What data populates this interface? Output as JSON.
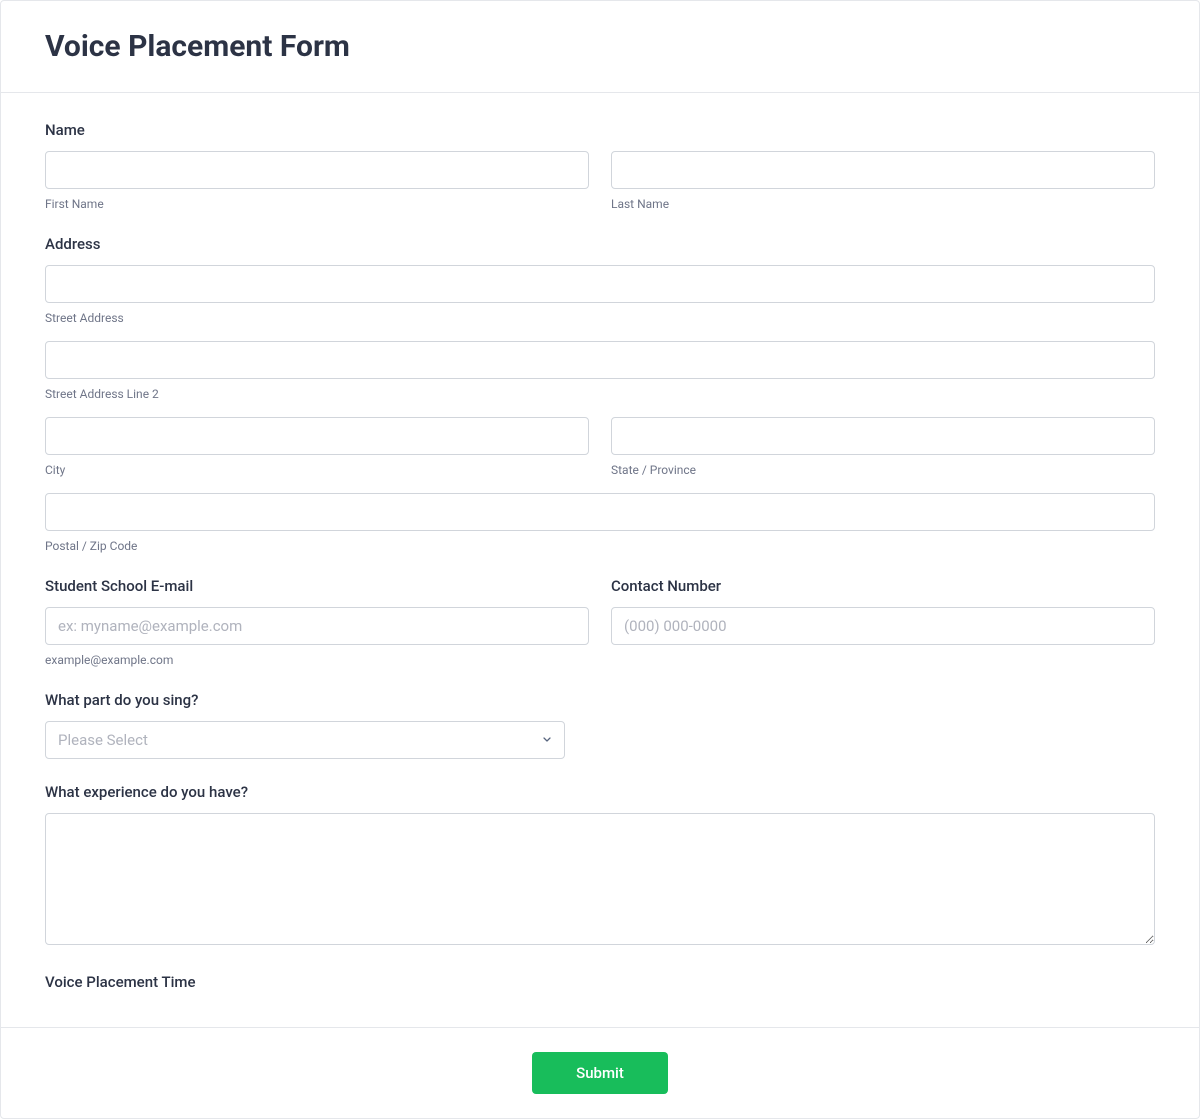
{
  "form": {
    "title": "Voice Placement Form",
    "name": {
      "label": "Name",
      "first_sublabel": "First Name",
      "last_sublabel": "Last Name"
    },
    "address": {
      "label": "Address",
      "street_sublabel": "Street Address",
      "street2_sublabel": "Street Address Line 2",
      "city_sublabel": "City",
      "state_sublabel": "State / Province",
      "postal_sublabel": "Postal / Zip Code"
    },
    "email": {
      "label": "Student School E-mail",
      "placeholder": "ex: myname@example.com",
      "sublabel": "example@example.com"
    },
    "phone": {
      "label": "Contact Number",
      "placeholder": "(000) 000-0000"
    },
    "voice_part": {
      "label": "What part do you sing?",
      "placeholder": "Please Select"
    },
    "experience": {
      "label": "What experience do you have?"
    },
    "placement_time": {
      "label": "Voice Placement Time"
    },
    "submit_label": "Submit"
  }
}
